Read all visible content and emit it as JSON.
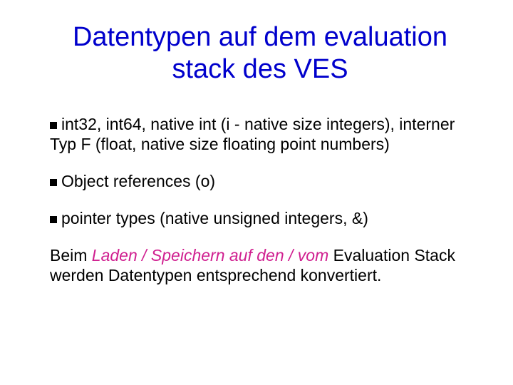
{
  "title": "Datentypen auf dem evaluation stack des VES",
  "bullets": [
    "int32, int64, native int (i - native size integers), interner Typ F (float, native size floating point numbers)",
    "Object references (o)",
    "pointer types (native unsigned integers, &)"
  ],
  "closing": {
    "pre": "Beim ",
    "emph": "Laden / Speichern auf den / vom",
    "post": " Evaluation Stack werden Datentypen entsprechend konvertiert."
  },
  "colors": {
    "title": "#0000cc",
    "emphasis": "#d02090"
  }
}
